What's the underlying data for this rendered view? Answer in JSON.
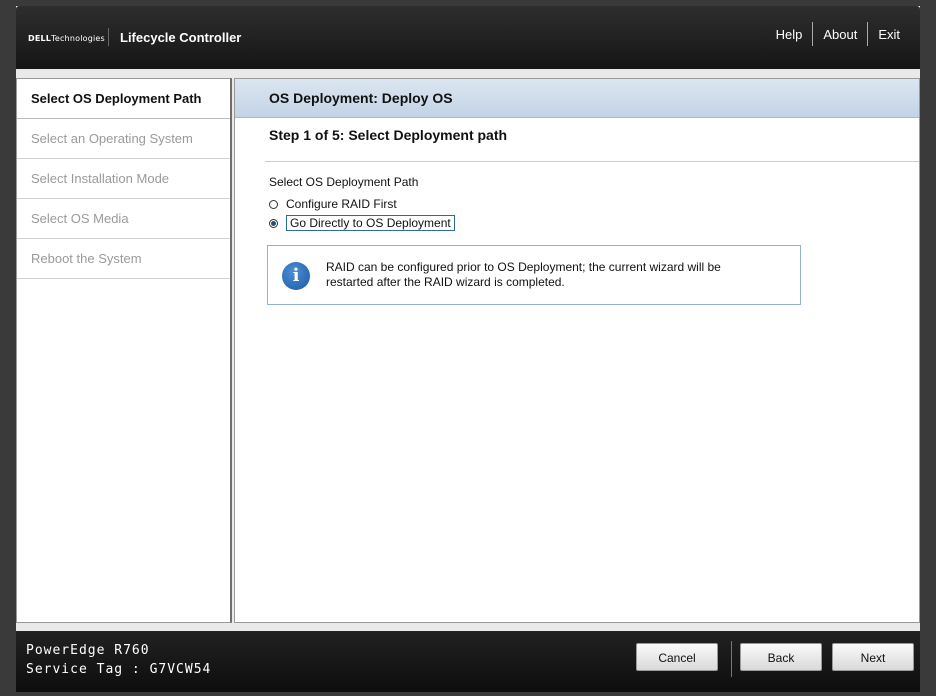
{
  "header": {
    "brand_main": "DELL",
    "brand_sub": "Technologies",
    "app_title": "Lifecycle Controller",
    "links": [
      "Help",
      "About",
      "Exit"
    ]
  },
  "sidebar": {
    "items": [
      {
        "label": "Select OS Deployment Path",
        "active": true
      },
      {
        "label": "Select an Operating System",
        "active": false
      },
      {
        "label": "Select Installation Mode",
        "active": false
      },
      {
        "label": "Select OS Media",
        "active": false
      },
      {
        "label": "Reboot the System",
        "active": false
      }
    ]
  },
  "main": {
    "title": "OS Deployment: Deploy OS",
    "step_title": "Step 1 of 5: Select Deployment path",
    "section_label": "Select OS Deployment Path",
    "options": [
      {
        "label": "Configure RAID First",
        "checked": false
      },
      {
        "label": "Go Directly to OS Deployment",
        "checked": true
      }
    ],
    "info_text": "RAID can be configured prior to OS Deployment; the current wizard will be restarted after the RAID wizard is completed.",
    "info_icon": "info-icon"
  },
  "footer": {
    "model": "PowerEdge R760",
    "service_tag": "Service Tag : G7VCW54",
    "cancel_label": "Cancel",
    "back_label": "Back",
    "next_label": "Next"
  }
}
